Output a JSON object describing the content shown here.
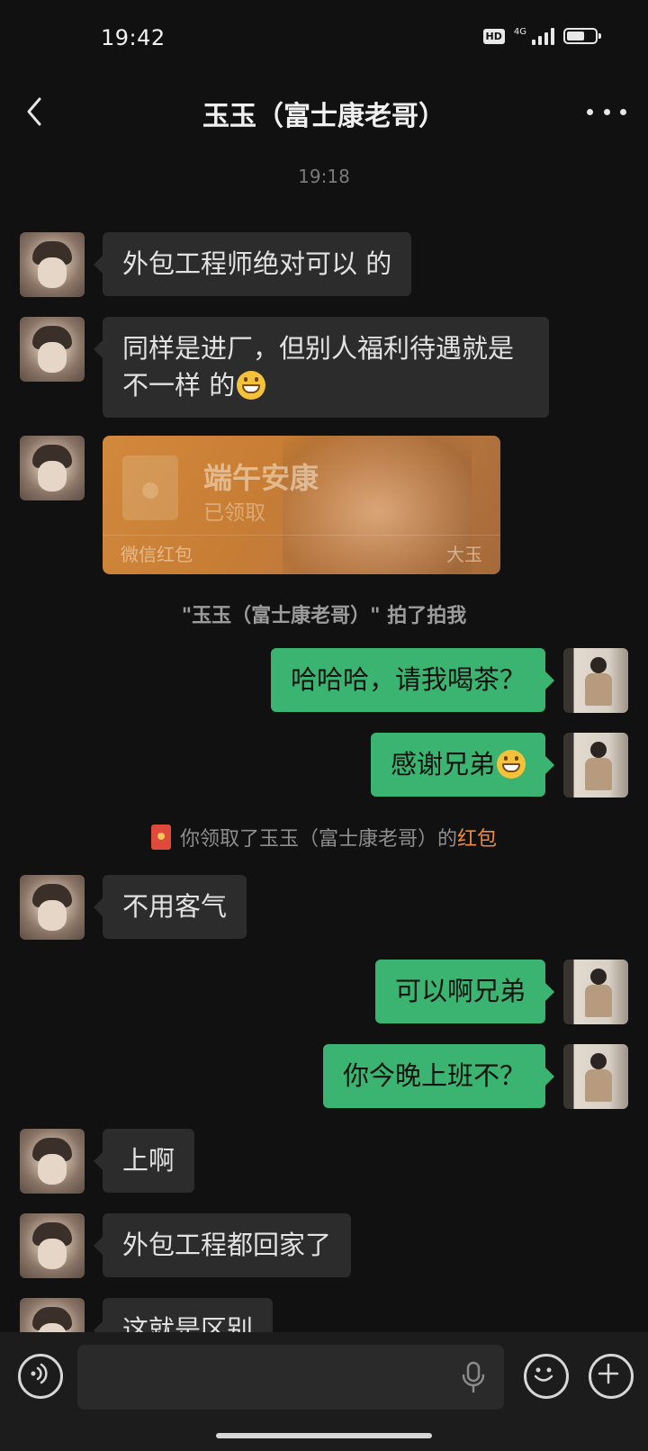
{
  "status_bar": {
    "time": "19:42",
    "hd_label": "HD",
    "network_label": "4G",
    "battery_level": 0.62
  },
  "nav": {
    "title": "玉玉（富士康老哥）",
    "back_icon": "back-arrow-icon",
    "more_icon": "more-dots-icon"
  },
  "chat": {
    "timestamp": "19:18",
    "messages": [
      {
        "sender": "them",
        "type": "text",
        "text": "外包工程师绝对可以 的"
      },
      {
        "sender": "them",
        "type": "text",
        "text": "同样是进厂，但别人福利待遇就是不一样 的",
        "emoji": "grin"
      },
      {
        "sender": "them",
        "type": "red_packet",
        "title": "端午安康",
        "status": "已领取",
        "brand": "微信红包",
        "sender_name": "大玉"
      },
      {
        "sender": "system",
        "type": "pat",
        "text": "\"玉玉（富士康老哥）\" 拍了拍我"
      },
      {
        "sender": "me",
        "type": "text",
        "text": "哈哈哈，请我喝茶？"
      },
      {
        "sender": "me",
        "type": "text",
        "text": "感谢兄弟",
        "emoji": "grin"
      },
      {
        "sender": "system",
        "type": "red_packet_notice",
        "text": "你领取了玉玉（富士康老哥）的",
        "link": "红包"
      },
      {
        "sender": "them",
        "type": "text",
        "text": "不用客气"
      },
      {
        "sender": "me",
        "type": "text",
        "text": "可以啊兄弟"
      },
      {
        "sender": "me",
        "type": "text",
        "text": "你今晚上班不？"
      },
      {
        "sender": "them",
        "type": "text",
        "text": "上啊"
      },
      {
        "sender": "them",
        "type": "text",
        "text": "外包工程都回家了"
      },
      {
        "sender": "them",
        "type": "text",
        "text": "这就是区别"
      }
    ]
  },
  "input_bar": {
    "voice_icon": "voice-input-icon",
    "text_value": "",
    "mic_icon": "microphone-icon",
    "emoji_icon": "emoji-icon",
    "plus_icon": "plus-icon"
  },
  "colors": {
    "background": "#111111",
    "bubble_them": "#2c2c2c",
    "bubble_me": "#3cb471",
    "red_packet_link": "#f08c3a"
  }
}
